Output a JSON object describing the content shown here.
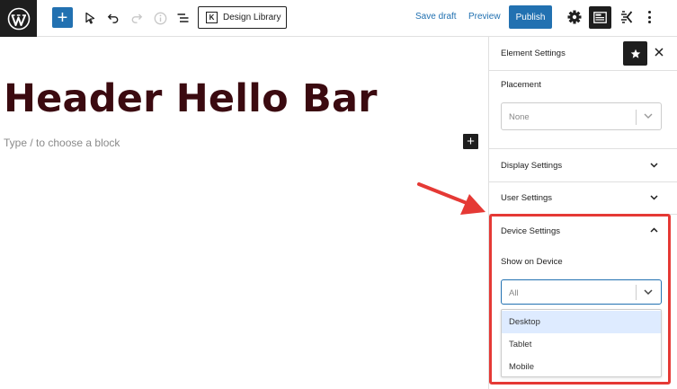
{
  "toolbar": {
    "add_label": "+",
    "design_library_label": "Design Library",
    "save_draft_label": "Save draft",
    "preview_label": "Preview",
    "publish_label": "Publish"
  },
  "editor": {
    "post_title": "Header Hello Bar",
    "block_placeholder": "Type / to choose a block",
    "inline_add_label": "+"
  },
  "sidebar": {
    "title": "Element Settings",
    "placement": {
      "label": "Placement",
      "value": "None"
    },
    "display_settings": "Display Settings",
    "user_settings": "User Settings",
    "device_settings": {
      "label": "Device Settings",
      "show_on_device_label": "Show on Device",
      "value": "All",
      "options": [
        "Desktop",
        "Tablet",
        "Mobile"
      ],
      "highlighted_option": "Desktop"
    }
  },
  "colors": {
    "accent": "#2271b1",
    "title": "#3b0a10",
    "highlight_box": "#e53935",
    "option_highlight": "#deebff"
  }
}
